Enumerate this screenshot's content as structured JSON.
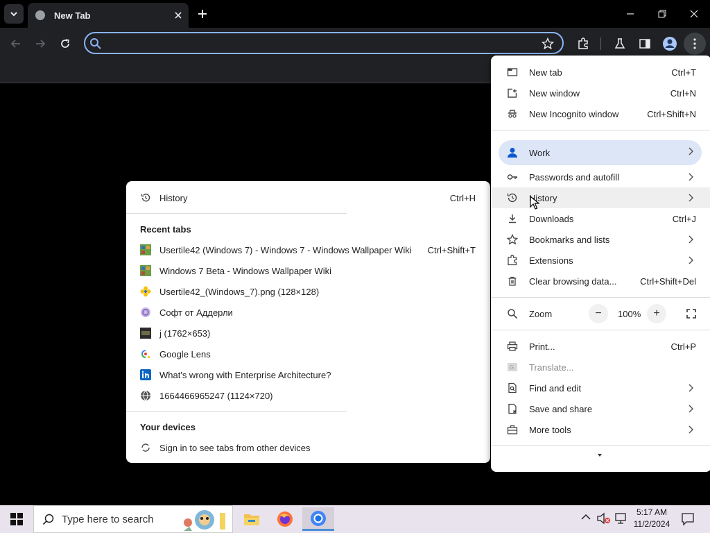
{
  "browser": {
    "tab_title": "New Tab",
    "omnibox_value": "",
    "omnibox_placeholder": ""
  },
  "main_menu": {
    "items": [
      {
        "label": "New tab",
        "shortcut": "Ctrl+T",
        "icon": "new-tab-icon"
      },
      {
        "label": "New window",
        "shortcut": "Ctrl+N",
        "icon": "new-window-icon"
      },
      {
        "label": "New Incognito window",
        "shortcut": "Ctrl+Shift+N",
        "icon": "incognito-icon"
      },
      {
        "label": "Work",
        "icon": "person-icon"
      },
      {
        "label": "Passwords and autofill",
        "icon": "key-icon"
      },
      {
        "label": "History",
        "icon": "history-icon"
      },
      {
        "label": "Downloads",
        "shortcut": "Ctrl+J",
        "icon": "download-icon"
      },
      {
        "label": "Bookmarks and lists",
        "icon": "star-icon"
      },
      {
        "label": "Extensions",
        "icon": "puzzle-icon"
      },
      {
        "label": "Clear browsing data...",
        "shortcut": "Ctrl+Shift+Del",
        "icon": "trash-icon"
      },
      {
        "label": "Zoom",
        "icon": "zoom-icon"
      },
      {
        "label": "Print...",
        "shortcut": "Ctrl+P",
        "icon": "print-icon"
      },
      {
        "label": "Translate...",
        "icon": "translate-icon"
      },
      {
        "label": "Find and edit",
        "icon": "find-icon"
      },
      {
        "label": "Save and share",
        "icon": "save-icon"
      },
      {
        "label": "More tools",
        "icon": "toolbox-icon"
      }
    ],
    "zoom_level": "100%",
    "zoom_minus": "−",
    "zoom_plus": "+"
  },
  "history_menu": {
    "history_label": "History",
    "history_shortcut": "Ctrl+H",
    "recent_tabs_heading": "Recent tabs",
    "recent_tabs": [
      {
        "title": "Usertile42 (Windows 7) - Windows 7 - Windows Wallpaper Wiki",
        "shortcut": "Ctrl+Shift+T",
        "favicon": "wiki-favicon"
      },
      {
        "title": "Windows 7 Beta - Windows Wallpaper Wiki",
        "favicon": "wiki-favicon"
      },
      {
        "title": "Usertile42_(Windows_7).png (128×128)",
        "favicon": "flower-favicon"
      },
      {
        "title": "Софт от Аддерли",
        "favicon": "site-favicon"
      },
      {
        "title": "j (1762×653)",
        "favicon": "image-favicon"
      },
      {
        "title": "Google Lens",
        "favicon": "lens-favicon"
      },
      {
        "title": "What's wrong with Enterprise Architecture?",
        "favicon": "linkedin-favicon"
      },
      {
        "title": "1664466965247 (1124×720)",
        "favicon": "globe-favicon"
      }
    ],
    "devices_heading": "Your devices",
    "devices_signin": "Sign in to see tabs from other devices"
  },
  "taskbar": {
    "search_placeholder": "Type here to search",
    "time": "5:17 AM",
    "date": "11/2/2024"
  }
}
